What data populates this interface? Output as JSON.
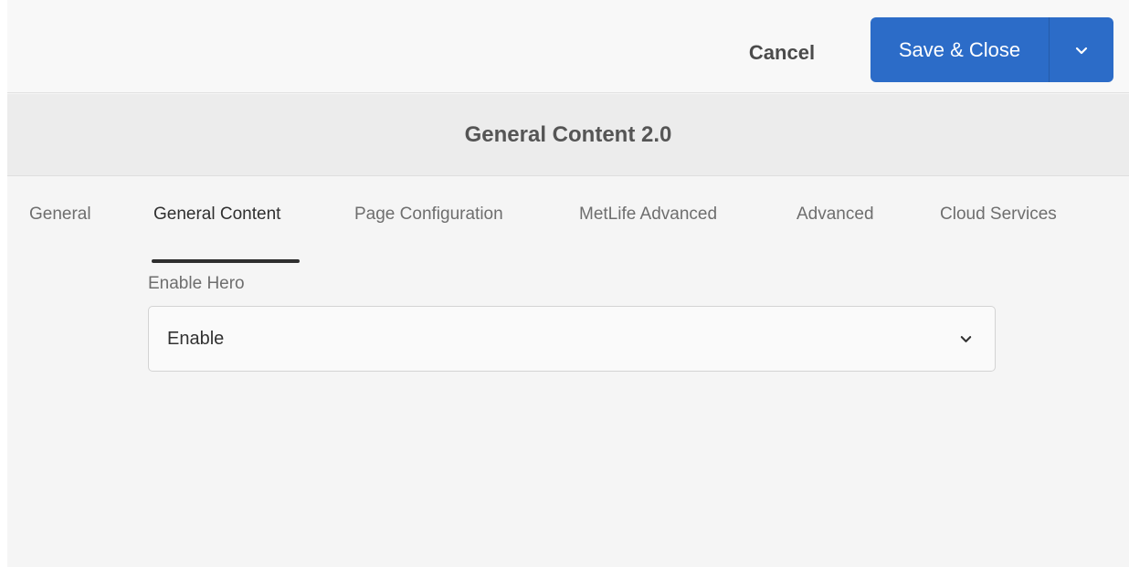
{
  "toolbar": {
    "cancel_label": "Cancel",
    "save_label": "Save & Close",
    "save_menu_icon": "chevron-down-icon"
  },
  "dialog": {
    "title": "General Content 2.0"
  },
  "tabs": [
    {
      "label": "General",
      "active": false
    },
    {
      "label": "General Content",
      "active": true
    },
    {
      "label": "Page Configuration",
      "active": false
    },
    {
      "label": "MetLife Advanced",
      "active": false
    },
    {
      "label": "Advanced",
      "active": false
    },
    {
      "label": "Cloud Services",
      "active": false
    }
  ],
  "form": {
    "enable_hero": {
      "label": "Enable Hero",
      "value": "Enable",
      "icon": "chevron-down-icon"
    }
  },
  "colors": {
    "primary_button": "#2c6cc8",
    "background": "#f5f5f5",
    "title_bar": "#ececec"
  }
}
